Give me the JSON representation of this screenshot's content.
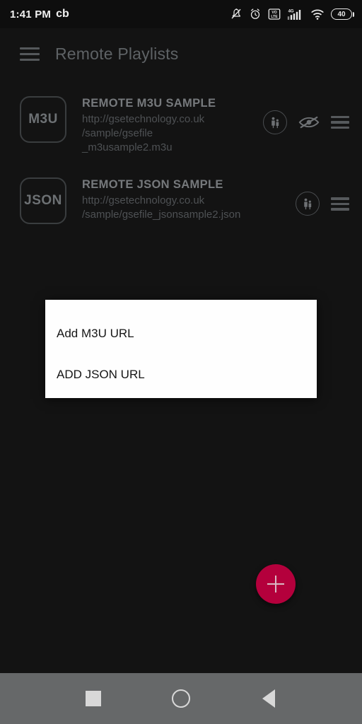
{
  "status_bar": {
    "time": "1:41 PM",
    "carrier_label": "cb",
    "icons": [
      {
        "name": "notifications-muted-icon",
        "glyph": "bell-off"
      },
      {
        "name": "alarm-icon",
        "glyph": "alarm"
      },
      {
        "name": "volte-icon",
        "glyph": "VoLTE"
      },
      {
        "name": "mobile-signal-4g-icon",
        "glyph": "4G"
      },
      {
        "name": "wifi-icon",
        "glyph": "wifi"
      }
    ],
    "battery_level": "40"
  },
  "app_bar": {
    "title": "Remote Playlists",
    "menu_icon": "hamburger-menu-icon"
  },
  "playlists": [
    {
      "badge": "M3U",
      "title": "REMOTE M3U SAMPLE",
      "url": "http://gsetechnology.co.uk\n/sample/gsefile\n_m3usample2.m3u",
      "actions": [
        "parental-control-icon",
        "visibility-off-icon",
        "drag-handle-icon"
      ]
    },
    {
      "badge": "JSON",
      "title": "REMOTE JSON SAMPLE",
      "url": "http://gsetechnology.co.uk\n/sample/gsefile_jsonsample2.json",
      "actions": [
        "parental-control-icon",
        "drag-handle-icon"
      ]
    }
  ],
  "dialog": {
    "items": [
      {
        "label": "Add M3U URL"
      },
      {
        "label": "ADD JSON URL"
      }
    ]
  },
  "fab": {
    "icon": "plus-icon",
    "color": "#b4003c"
  },
  "nav_bar": {
    "recents_label": "recents-square-icon",
    "home_label": "home-circle-icon",
    "back_label": "back-triangle-icon"
  },
  "colors": {
    "background": "#131313",
    "dialog_background": "#fefefe",
    "accent": "#b4003c",
    "nav_bar": "#666869",
    "muted_text": "#4e5154"
  }
}
